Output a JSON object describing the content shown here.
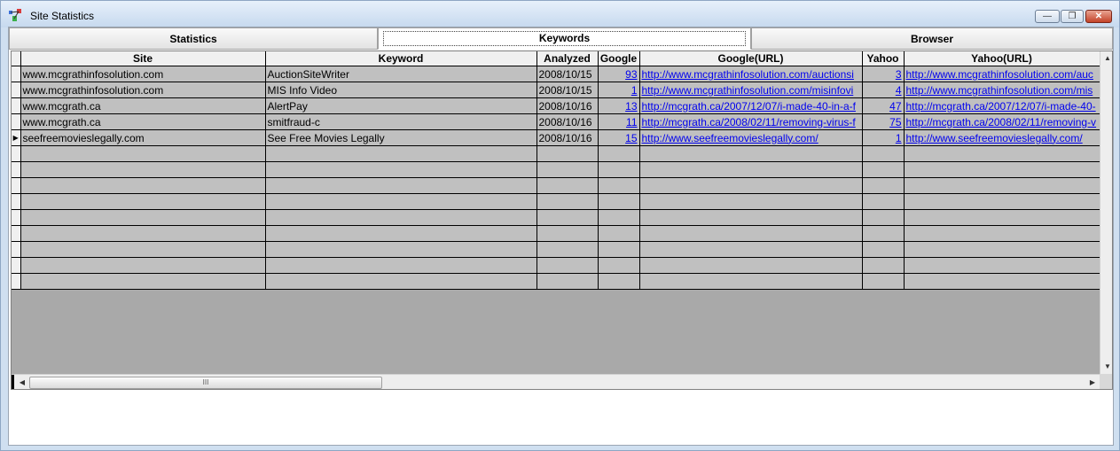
{
  "window": {
    "title": "Site Statistics",
    "minimize_glyph": "—",
    "maximize_glyph": "❐",
    "close_glyph": "✕"
  },
  "tabs": [
    {
      "label": "Statistics"
    },
    {
      "label": "Keywords"
    },
    {
      "label": "Browser"
    }
  ],
  "grid": {
    "columns": [
      "Site",
      "Keyword",
      "Analyzed",
      "Google",
      "Google(URL)",
      "Yahoo",
      "Yahoo(URL)"
    ],
    "rows": [
      {
        "site": "www.mcgrathinfosolution.com",
        "keyword": "AuctionSiteWriter",
        "analyzed": "2008/10/15",
        "google": "93",
        "google_url": "http://www.mcgrathinfosolution.com/auctionsi",
        "yahoo": "3",
        "yahoo_url": "http://www.mcgrathinfosolution.com/auc"
      },
      {
        "site": "www.mcgrathinfosolution.com",
        "keyword": "MIS Info Video",
        "analyzed": "2008/10/15",
        "google": "1",
        "google_url": "http://www.mcgrathinfosolution.com/misinfovi",
        "yahoo": "4",
        "yahoo_url": "http://www.mcgrathinfosolution.com/mis"
      },
      {
        "site": "www.mcgrath.ca",
        "keyword": "AlertPay",
        "analyzed": "2008/10/16",
        "google": "13",
        "google_url": "http://mcgrath.ca/2007/12/07/i-made-40-in-a-f",
        "yahoo": "47",
        "yahoo_url": "http://mcgrath.ca/2007/12/07/i-made-40-"
      },
      {
        "site": "www.mcgrath.ca",
        "keyword": "smitfraud-c",
        "analyzed": "2008/10/16",
        "google": "11",
        "google_url": "http://mcgrath.ca/2008/02/11/removing-virus-f",
        "yahoo": "75",
        "yahoo_url": "http://mcgrath.ca/2008/02/11/removing-v"
      },
      {
        "site": "seefreemovieslegally.com",
        "keyword": "See Free Movies Legally",
        "analyzed": "2008/10/16",
        "google": "15",
        "google_url": "http://www.seefreemovieslegally.com/",
        "yahoo": "1",
        "yahoo_url": "http://www.seefreemovieslegally.com/"
      }
    ],
    "current_row_marker": "▶",
    "scroll_up": "▲",
    "scroll_down": "▼",
    "scroll_left": "◀",
    "scroll_right": "▶",
    "thumb_grip": "III"
  }
}
